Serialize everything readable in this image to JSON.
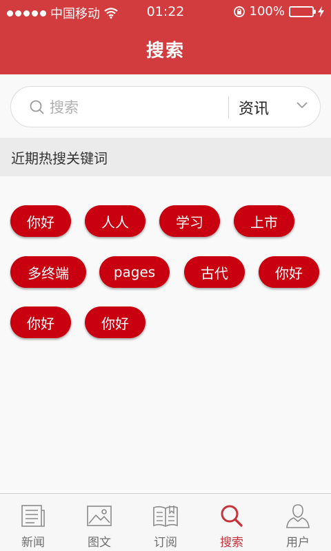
{
  "status_bar": {
    "carrier": "中国移动",
    "time": "01:22",
    "battery": "100%",
    "battery_level": 1.0
  },
  "header": {
    "title": "搜索"
  },
  "search": {
    "placeholder": "搜索",
    "value": "",
    "category": "资讯"
  },
  "hot_section": {
    "title": "近期热搜关键词",
    "tags": [
      "你好",
      "人人",
      "学习",
      "上市",
      "多终端",
      "pages",
      "古代",
      "你好",
      "你好",
      "你好"
    ]
  },
  "tabbar": {
    "tabs": [
      {
        "label": "新闻",
        "icon": "newspaper-icon"
      },
      {
        "label": "图文",
        "icon": "image-icon"
      },
      {
        "label": "订阅",
        "icon": "book-icon"
      },
      {
        "label": "搜索",
        "icon": "search-icon"
      },
      {
        "label": "用户",
        "icon": "user-icon"
      }
    ],
    "active": "搜索"
  },
  "colors": {
    "brand": "#d23c3f",
    "tag": "#c8000f",
    "battery": "#4cd964",
    "active_tab": "#c8323a"
  }
}
